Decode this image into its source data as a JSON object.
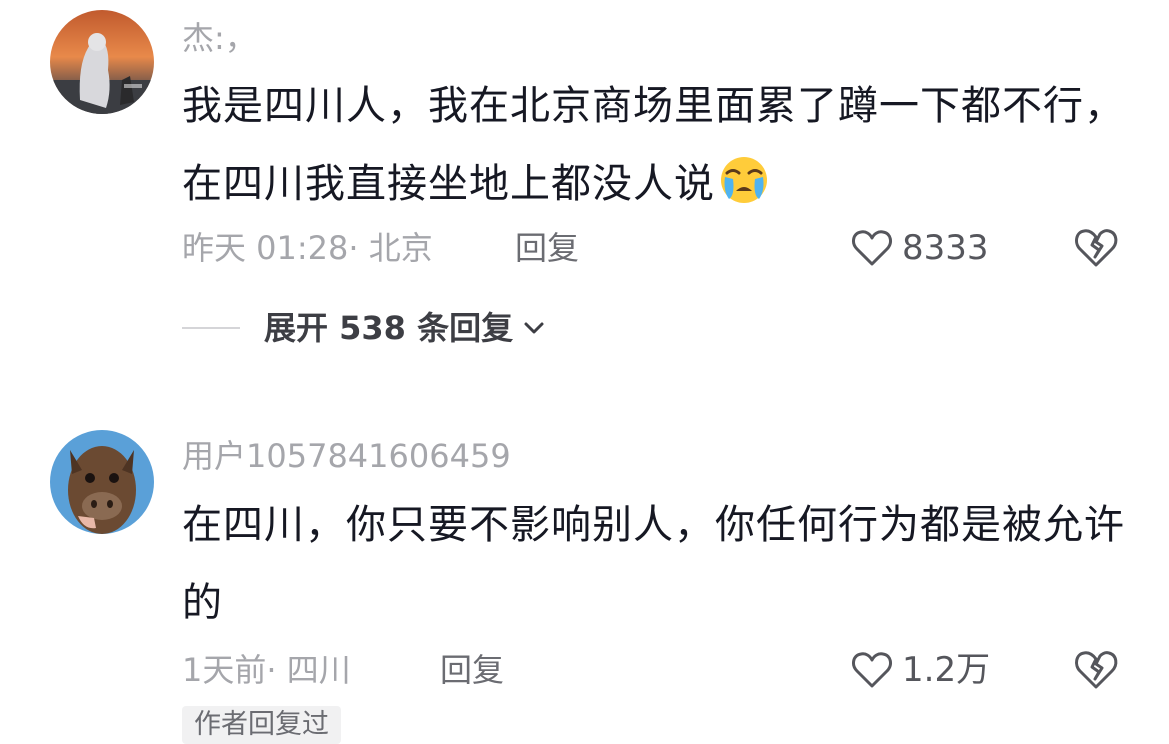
{
  "comments": [
    {
      "username": "杰:，",
      "text": "我是四川人，我在北京商场里面累了蹲一下都不行，在四川我直接坐地上都没人说",
      "emoji": "crying-face",
      "time": "昨天 01:28",
      "location": "· 北京",
      "reply_label": "回复",
      "likes": "8333",
      "expand_label": "展开 538 条回复"
    },
    {
      "username": "用户1057841606459",
      "text": "在四川，你只要不影响别人，你任何行为都是被允许的",
      "time": "1天前",
      "location": "· 四川",
      "reply_label": "回复",
      "likes": "1.2万",
      "badge": "作者回复过"
    }
  ],
  "colors": {
    "primary_text": "#161823",
    "secondary_text": "#a5a6ab",
    "icon": "#55565c",
    "badge_bg": "#f1f1f2"
  },
  "icons": [
    "heart-outline-icon",
    "broken-heart-icon",
    "chevron-down-icon",
    "crying-face-emoji"
  ]
}
